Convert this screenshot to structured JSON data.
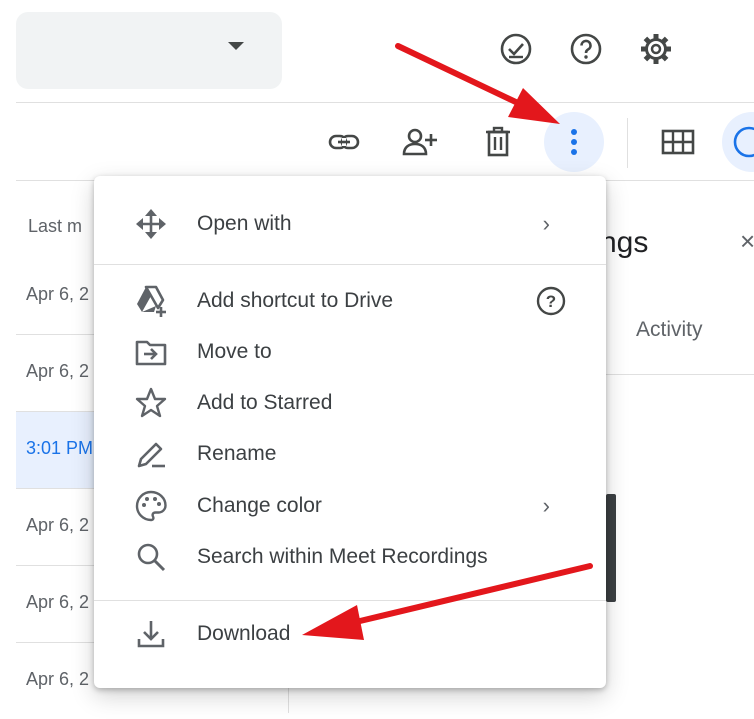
{
  "list": {
    "column_header": "Last m",
    "rows": [
      {
        "date": "Apr 6, 2"
      },
      {
        "date": "Apr 6, 2"
      },
      {
        "date": "3:01 PM"
      },
      {
        "date": "Apr 6, 2"
      },
      {
        "date": "Apr 6, 2"
      },
      {
        "date": "Apr 6, 2"
      }
    ]
  },
  "details": {
    "title": "ngs",
    "close": "×",
    "tab": "Activity"
  },
  "menu": {
    "items": [
      {
        "label": "Open with",
        "icon": "open-with-icon",
        "right": "›"
      },
      {
        "label": "Add shortcut to Drive",
        "icon": "add-shortcut-icon",
        "right": "?"
      },
      {
        "label": "Move to",
        "icon": "move-to-icon"
      },
      {
        "label": "Add to Starred",
        "icon": "star-icon"
      },
      {
        "label": "Rename",
        "icon": "rename-icon"
      },
      {
        "label": "Change color",
        "icon": "palette-icon",
        "right": "›"
      },
      {
        "label": "Search within Meet Recordings",
        "icon": "search-icon"
      },
      {
        "label": "Download",
        "icon": "download-icon"
      }
    ]
  },
  "colors": {
    "accent": "#1a73e8",
    "selected_row": "#e8f0fe",
    "annotation_arrow": "#e3171c"
  }
}
